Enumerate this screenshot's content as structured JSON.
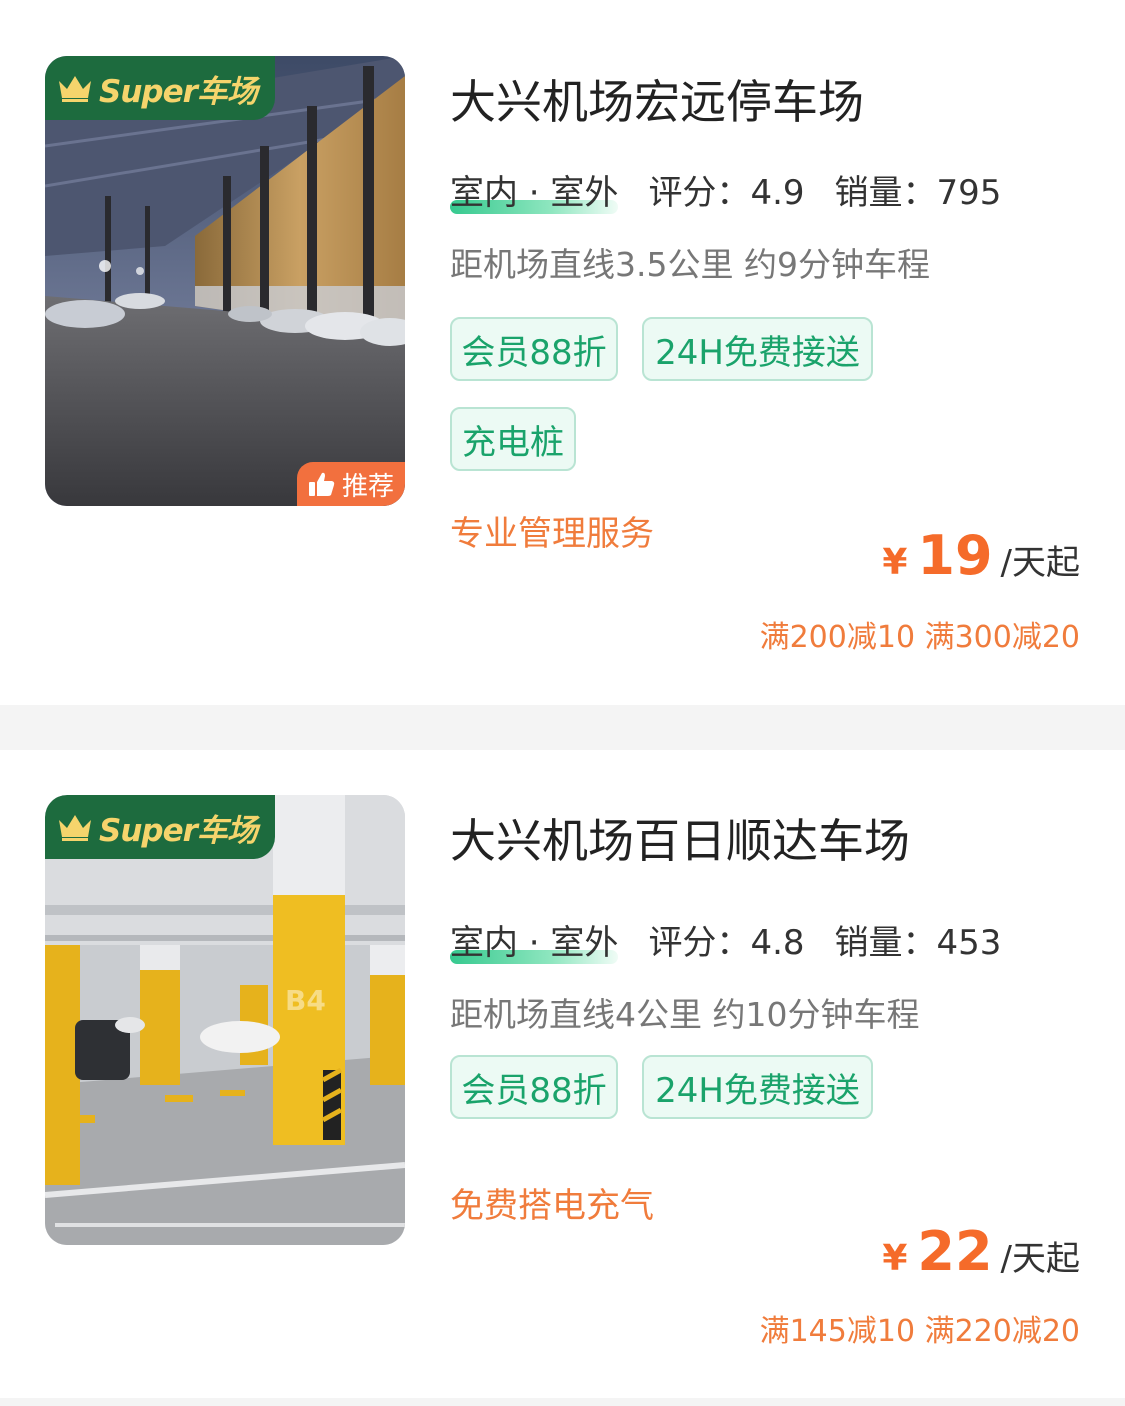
{
  "cards": [
    {
      "name": "大兴机场宏远停车场",
      "super_label": "Super车场",
      "recommend_label": "推荐",
      "type": "室内 · 室外",
      "rating_label": "评分：",
      "rating": "4.9",
      "sales_label": "销量：",
      "sales": "795",
      "distance": "距机场直线3.5公里 约9分钟车程",
      "tags": [
        "会员88折",
        "24H免费接送",
        "充电桩"
      ],
      "feature": "专业管理服务",
      "currency": "¥",
      "price": "19",
      "price_unit": "/天起",
      "discount": "满200减10 满300减20"
    },
    {
      "name": "大兴机场百日顺达车场",
      "super_label": "Super车场",
      "type": "室内 · 室外",
      "rating_label": "评分：",
      "rating": "4.8",
      "sales_label": "销量：",
      "sales": "453",
      "distance": "距机场直线4公里 约10分钟车程",
      "tags": [
        "会员88折",
        "24H免费接送"
      ],
      "feature": "免费搭电充气",
      "currency": "¥",
      "price": "22",
      "price_unit": "/天起",
      "discount": "满145减10 满220减20"
    }
  ],
  "colors": {
    "accent_orange": "#f56b2a",
    "tag_green": "#1aa36b",
    "badge_green": "#1d6b3e",
    "badge_gold": "#f5d46c"
  }
}
